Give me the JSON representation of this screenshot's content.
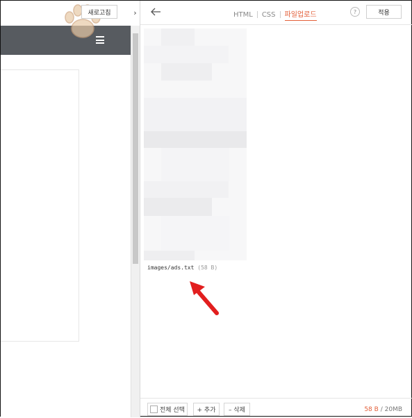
{
  "preview": {
    "refresh_label": "새로고침",
    "collapse_glyph": "›",
    "accent_bar_color": "#575b60"
  },
  "editor": {
    "tabs": [
      {
        "label": "HTML",
        "active": false
      },
      {
        "label": "CSS",
        "active": false
      },
      {
        "label": "파일업로드",
        "active": true
      }
    ],
    "help_label": "?",
    "apply_label": "적용",
    "accent_color": "#e35f39"
  },
  "file": {
    "name": "images/ads.txt",
    "size": "(58 B)"
  },
  "footer": {
    "select_all_label": "전체 선택",
    "add_label": "+ 추가",
    "delete_label": "– 삭제",
    "used": "58 B",
    "total": "/ 20MB"
  }
}
